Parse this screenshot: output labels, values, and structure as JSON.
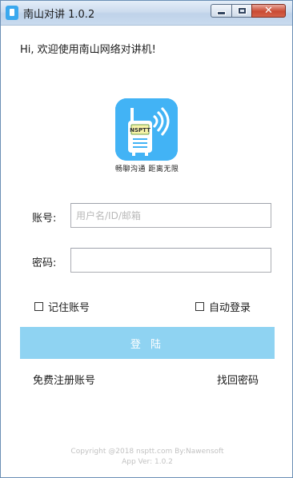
{
  "window": {
    "title": "南山对讲 1.0.2",
    "close_glyph": "✕"
  },
  "welcome_text": "Hi, 欢迎使用南山网络对讲机!",
  "logo": {
    "badge_text": "NSPTT",
    "slogan": "畅聊沟通 距离无限",
    "background_color": "#42b3f5"
  },
  "form": {
    "account_label": "账号:",
    "account_placeholder": "用户名/ID/邮箱",
    "account_value": "",
    "password_label": "密码:",
    "password_value": "",
    "remember_label": "记住账号",
    "remember_checked": false,
    "auto_login_label": "自动登录",
    "auto_login_checked": false,
    "login_button": "登 陆",
    "login_button_color": "#8fd3f2"
  },
  "links": {
    "register": "免费注册账号",
    "recover_password": "找回密码"
  },
  "footer": {
    "copyright": "Copyright @2018 nsptt.com By:Nawensoft",
    "version": "App Ver: 1.0.2"
  }
}
